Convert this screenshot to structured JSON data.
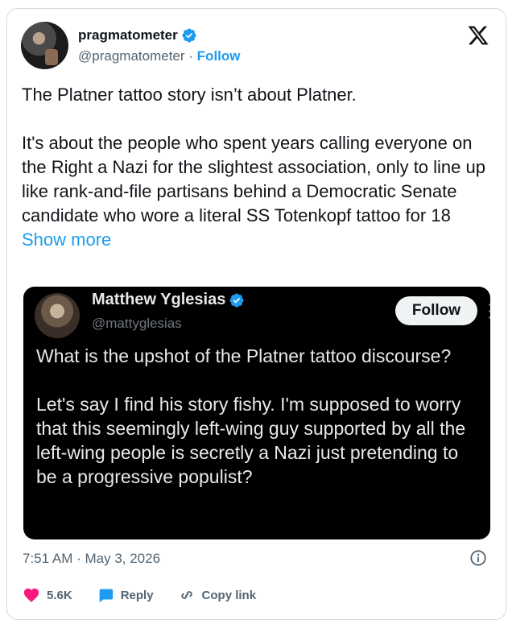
{
  "author": {
    "name": "pragmatometer",
    "handle": "@pragmatometer",
    "separator": "·",
    "follow_label": "Follow"
  },
  "tweet": {
    "text": "The Platner tattoo story isn’t about Platner.\n\nIt's about the people who spent years calling everyone on the Right a Nazi for the slightest association, only to line up like rank-and-file partisans behind a Democratic Senate candidate who wore a literal SS Totenkopf tattoo for 18 ",
    "show_more": "Show more",
    "timestamp": "7:51 AM · May 3, 2026"
  },
  "quoted": {
    "name": "Matthew Yglesias",
    "handle": "@mattyglesias",
    "follow_label": "Follow",
    "text": "What is the upshot of the Platner tattoo discourse?\n\nLet's say I find his story fishy. I'm supposed to worry that this seemingly left-wing guy supported by all the left-wing people is secretly a Nazi just pretending to be a progressive populist?"
  },
  "actions": {
    "likes": "5.6K",
    "reply": "Reply",
    "copy": "Copy link"
  },
  "colors": {
    "accent": "#1d9bf0",
    "verified": "#1d9bf0",
    "muted": "#536471",
    "like": "#f91880"
  }
}
